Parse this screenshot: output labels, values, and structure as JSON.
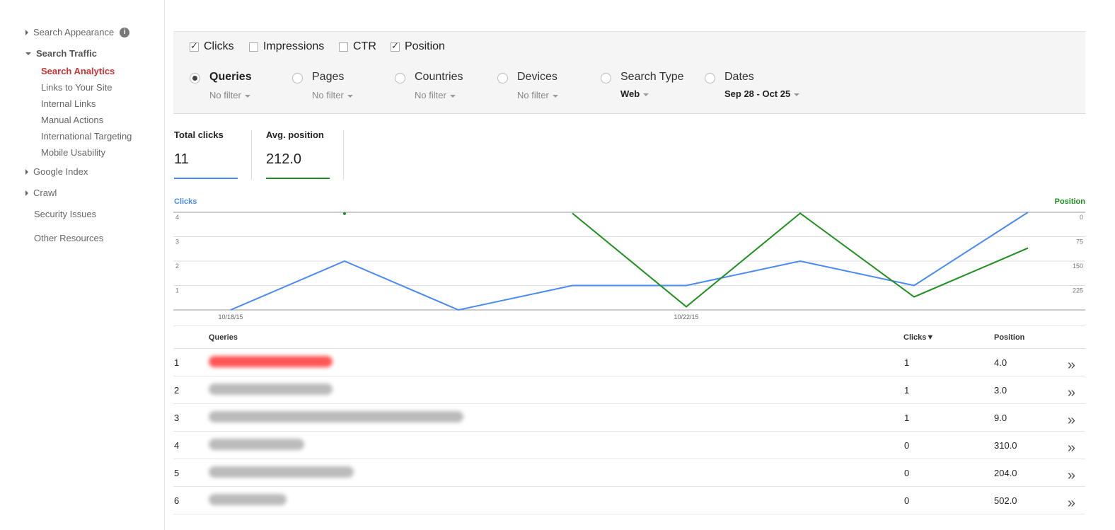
{
  "sidebar": {
    "search_appearance": "Search Appearance",
    "search_traffic": "Search Traffic",
    "search_analytics": "Search Analytics",
    "links_to_site": "Links to Your Site",
    "internal_links": "Internal Links",
    "manual_actions": "Manual Actions",
    "international_targeting": "International Targeting",
    "mobile_usability": "Mobile Usability",
    "google_index": "Google Index",
    "crawl": "Crawl",
    "security_issues": "Security Issues",
    "other_resources": "Other Resources",
    "info_glyph": "i"
  },
  "metrics": {
    "clicks": {
      "label": "Clicks",
      "checked": true
    },
    "impressions": {
      "label": "Impressions",
      "checked": false
    },
    "ctr": {
      "label": "CTR",
      "checked": false
    },
    "position": {
      "label": "Position",
      "checked": true
    }
  },
  "dimensions": {
    "queries": {
      "label": "Queries",
      "filter": "No filter",
      "selected": true
    },
    "pages": {
      "label": "Pages",
      "filter": "No filter"
    },
    "countries": {
      "label": "Countries",
      "filter": "No filter"
    },
    "devices": {
      "label": "Devices",
      "filter": "No filter"
    },
    "search_type": {
      "label": "Search Type",
      "filter": "Web"
    },
    "dates": {
      "label": "Dates",
      "filter": "Sep 28 - Oct 25"
    }
  },
  "totals": {
    "clicks_label": "Total clicks",
    "clicks_value": "11",
    "position_label": "Avg. position",
    "position_value": "212.0"
  },
  "colors": {
    "clicks": "#4a8af4",
    "position": "#1e8f1e"
  },
  "chart_data": {
    "type": "line",
    "left_axis_title": "Clicks",
    "right_axis_title": "Position",
    "x": [
      "10/18/15",
      "10/19/15",
      "10/20/15",
      "10/21/15",
      "10/22/15",
      "10/23/15",
      "10/24/15",
      "10/25/15"
    ],
    "x_tick_labels": [
      "10/18/15",
      "10/22/15"
    ],
    "left_ticks": [
      "4",
      "3",
      "2",
      "1"
    ],
    "right_ticks": [
      "0",
      "75",
      "150",
      "225"
    ],
    "ylim_left": [
      0,
      4
    ],
    "ylim_right": [
      300,
      0
    ],
    "series": [
      {
        "name": "Clicks",
        "axis": "left",
        "values": [
          0,
          2,
          0,
          1,
          1,
          2,
          1,
          4
        ]
      },
      {
        "name": "Position",
        "axis": "right",
        "values": [
          null,
          4,
          null,
          3,
          290,
          3,
          260,
          110
        ]
      }
    ],
    "grid": true
  },
  "table": {
    "headers": {
      "queries": "Queries",
      "clicks": "Clicks▼",
      "position": "Position"
    },
    "rows": [
      {
        "n": "1",
        "clicks": "1",
        "position": "4.0",
        "blur_width": 175,
        "red": true
      },
      {
        "n": "2",
        "clicks": "1",
        "position": "3.0",
        "blur_width": 175
      },
      {
        "n": "3",
        "clicks": "1",
        "position": "9.0",
        "blur_width": 360
      },
      {
        "n": "4",
        "clicks": "0",
        "position": "310.0",
        "blur_width": 135
      },
      {
        "n": "5",
        "clicks": "0",
        "position": "204.0",
        "blur_width": 205
      },
      {
        "n": "6",
        "clicks": "0",
        "position": "502.0",
        "blur_width": 110
      }
    ],
    "row_action_glyph": "»"
  }
}
